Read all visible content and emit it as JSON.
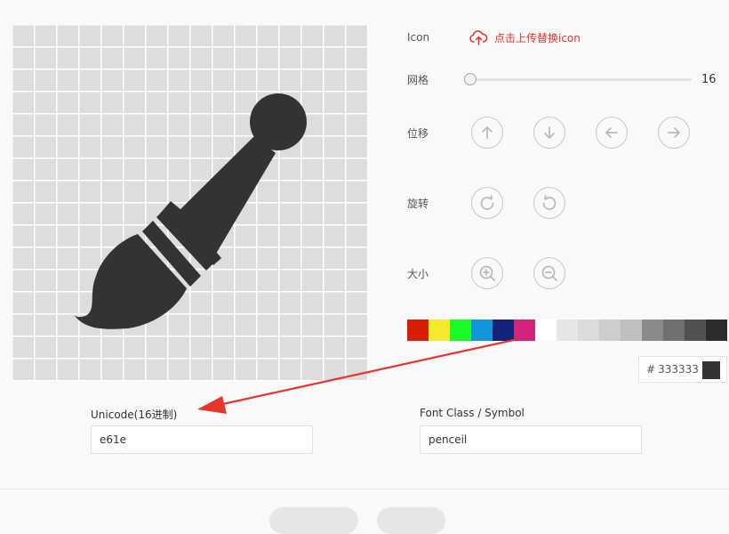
{
  "canvas": {
    "grid_cells": 16,
    "icon_color": "#333333",
    "grid_color": "#dddddd",
    "icon_name": "paintbrush-icon"
  },
  "labels": {
    "icon": "Icon",
    "grid": "网格",
    "move": "位移",
    "rotate": "旋转",
    "size": "大小"
  },
  "upload": {
    "label": "点击上传替换icon",
    "icon": "cloud-upload-icon",
    "color": "#e0332b"
  },
  "grid_slider": {
    "value": "16",
    "min": 16
  },
  "move_buttons": [
    {
      "icon": "arrow-up-icon"
    },
    {
      "icon": "arrow-down-icon"
    },
    {
      "icon": "arrow-left-icon"
    },
    {
      "icon": "arrow-right-icon"
    }
  ],
  "rotate_buttons": [
    {
      "icon": "rotate-clockwise-icon"
    },
    {
      "icon": "rotate-counterclockwise-icon"
    }
  ],
  "size_buttons": [
    {
      "icon": "zoom-in-icon"
    },
    {
      "icon": "zoom-out-icon"
    }
  ],
  "palette": [
    "#d81e06",
    "#f4ea2a",
    "#1afa29",
    "#1296db",
    "#13227a",
    "#d4237a",
    "#ffffff",
    "#e6e6e6",
    "#dbdbdb",
    "#cdcdcd",
    "#bfbfbf",
    "#8a8a8a",
    "#707070",
    "#515151",
    "#2c2c2c"
  ],
  "color_input": {
    "hash": "#",
    "value": "333333",
    "swatch": "#333333"
  },
  "unicode": {
    "label": "Unicode(16进制)",
    "value": "e61e"
  },
  "font_class": {
    "label": "Font Class / Symbol",
    "value": "penceil"
  },
  "annotation": {
    "arrow_color": "#e8352a"
  }
}
